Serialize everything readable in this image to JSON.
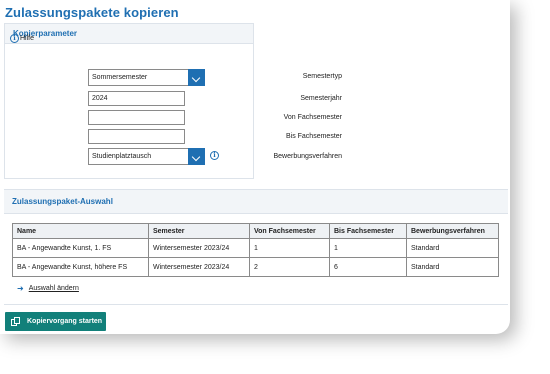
{
  "page": {
    "title": "Zulassungspakete kopieren"
  },
  "kopierparameter": {
    "heading": "Kopierparameter",
    "help_label": "Hilfe",
    "semestertyp": {
      "label": "Semestertyp",
      "value": "Sommersemester"
    },
    "semesterjahr": {
      "label": "Semesterjahr",
      "value": "2024"
    },
    "von_fachsemester": {
      "label": "Von Fachsemester",
      "value": ""
    },
    "bis_fachsemester": {
      "label": "Bis Fachsemester",
      "value": ""
    },
    "bewerbungsverfahren": {
      "label": "Bewerbungsverfahren",
      "value": "Studienplatztausch"
    }
  },
  "auswahl": {
    "heading": "Zulassungspaket-Auswahl",
    "columns": [
      "Name",
      "Semester",
      "Von Fachsemester",
      "Bis Fachsemester",
      "Bewerbungsverfahren"
    ],
    "rows": [
      [
        "BA - Angewandte Kunst, 1. FS",
        "Wintersemester 2023/24",
        "1",
        "1",
        "Standard"
      ],
      [
        "BA - Angewandte Kunst, höhere FS",
        "Wintersemester 2023/24",
        "2",
        "6",
        "Standard"
      ]
    ],
    "change_link": "Auswahl ändern"
  },
  "start_button": "Kopiervorgang starten",
  "colors": {
    "accent": "#1f6fb2",
    "button": "#12807a"
  }
}
